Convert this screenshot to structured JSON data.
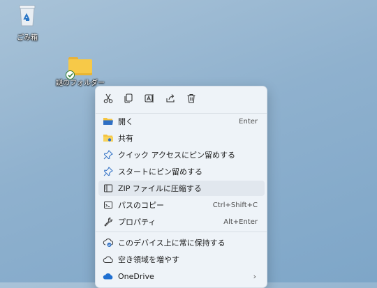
{
  "desktop": {
    "icons": [
      {
        "label": "ごみ箱",
        "icon": "recycle-bin-icon"
      },
      {
        "label": "謎のフォルダー",
        "icon": "folder-icon",
        "badge": "synced-check-icon"
      }
    ]
  },
  "context_menu": {
    "toolbar": [
      {
        "icon": "cut-icon"
      },
      {
        "icon": "copy-icon"
      },
      {
        "icon": "rename-icon"
      },
      {
        "icon": "share-icon"
      },
      {
        "icon": "delete-icon"
      }
    ],
    "items": [
      {
        "label": "開く",
        "shortcut": "Enter",
        "icon": "folder-open-icon"
      },
      {
        "label": "共有",
        "icon": "shared-folder-icon"
      },
      {
        "label": "クイック アクセスにピン留めする",
        "icon": "pin-icon"
      },
      {
        "label": "スタートにピン留めする",
        "icon": "pin-icon"
      },
      {
        "label": "ZIP ファイルに圧縮する",
        "icon": "zip-icon",
        "highlighted": true
      },
      {
        "label": "パスのコピー",
        "shortcut": "Ctrl+Shift+C",
        "icon": "path-copy-icon"
      },
      {
        "label": "プロパティ",
        "shortcut": "Alt+Enter",
        "icon": "wrench-icon"
      },
      {
        "label": "このデバイス上に常に保持する",
        "icon": "cloud-keep-icon"
      },
      {
        "label": "空き領域を増やす",
        "icon": "cloud-outline-icon"
      },
      {
        "label": "OneDrive",
        "icon": "onedrive-icon",
        "submenu": true
      }
    ]
  },
  "colors": {
    "accent": "#2f6fc4",
    "folder": "#f7c948",
    "sync_green": "#2e7d32",
    "onedrive": "#1f6fd1"
  }
}
